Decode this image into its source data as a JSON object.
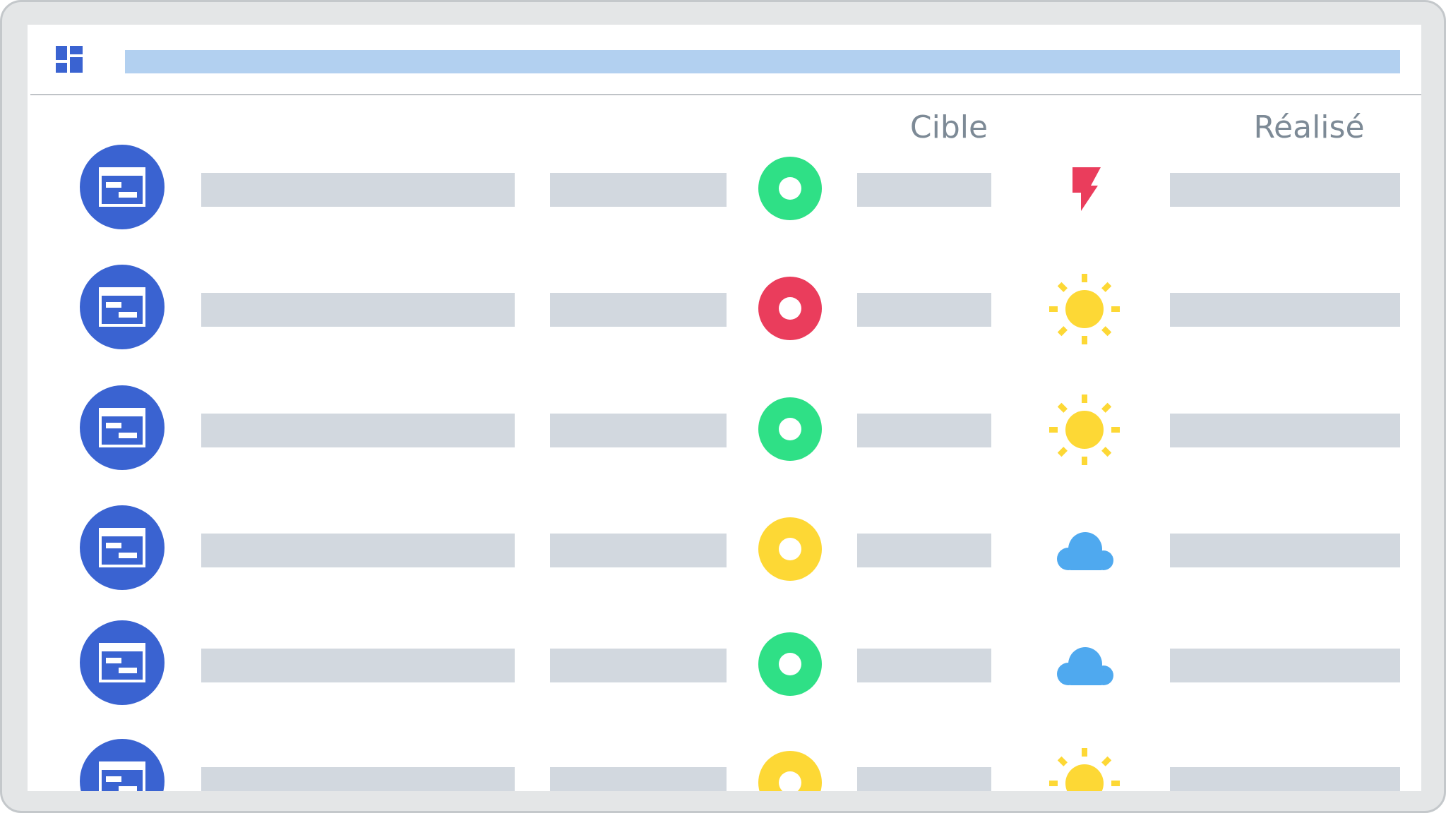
{
  "header": {
    "apps_icon": "grid-icon",
    "title": ""
  },
  "columns": {
    "cible": "Cible",
    "realise": "Réalisé"
  },
  "colors": {
    "primary_blue": "#3a63d1",
    "status_green": "#2fe086",
    "status_red": "#ea3d5c",
    "status_yellow": "#fdd835",
    "weather_red": "#ea3d5c",
    "weather_sun": "#fdd835",
    "weather_cloud": "#4fa9ef",
    "placeholder": "#d2d8df"
  },
  "rows": [
    {
      "icon": "report-icon",
      "status": "green",
      "status_color": "#2fe086",
      "weather": "storm"
    },
    {
      "icon": "report-icon",
      "status": "red",
      "status_color": "#ea3d5c",
      "weather": "sun"
    },
    {
      "icon": "report-icon",
      "status": "green",
      "status_color": "#2fe086",
      "weather": "sun"
    },
    {
      "icon": "report-icon",
      "status": "yellow",
      "status_color": "#fdd835",
      "weather": "cloud"
    },
    {
      "icon": "report-icon",
      "status": "green",
      "status_color": "#2fe086",
      "weather": "cloud"
    },
    {
      "icon": "report-icon",
      "status": "yellow",
      "status_color": "#fdd835",
      "weather": "sun"
    }
  ]
}
